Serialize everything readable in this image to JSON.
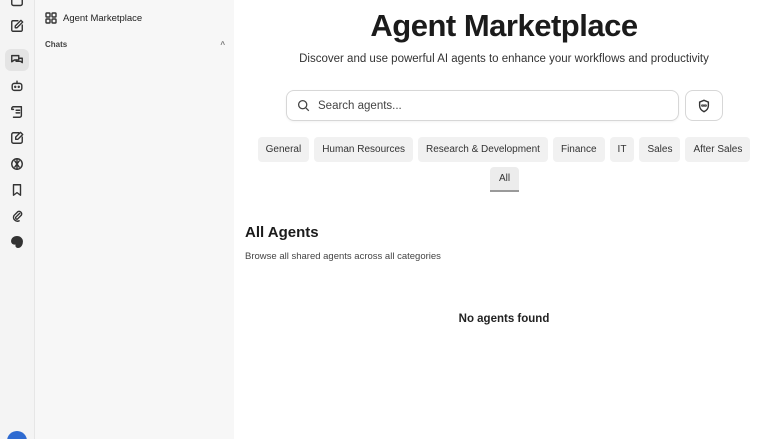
{
  "rail": {
    "icons": [
      "new-chat-icon",
      "chats-icon",
      "bot-icon",
      "prompts-icon",
      "edit-icon",
      "globe-icon",
      "bookmark-icon",
      "attachment-icon",
      "palette-icon"
    ]
  },
  "panel": {
    "marketplace_label": "Agent Marketplace",
    "chats_header": "Chats",
    "chats_caret": "^"
  },
  "main": {
    "title": "Agent Marketplace",
    "subtitle": "Discover and use powerful AI agents to enhance your workflows and productivity",
    "search_placeholder": "Search agents...",
    "categories": [
      "General",
      "Human Resources",
      "Research & Development",
      "Finance",
      "IT",
      "Sales",
      "After Sales"
    ],
    "active_category": "All",
    "section_title": "All Agents",
    "section_subtitle": "Browse all shared agents across all categories",
    "empty_state": "No agents found"
  },
  "colors": {
    "accent": "#2f6bd1",
    "rail_bg": "#f4f4f4",
    "panel_bg": "#f7f7f7",
    "tab_bg": "#f1f1f1"
  }
}
